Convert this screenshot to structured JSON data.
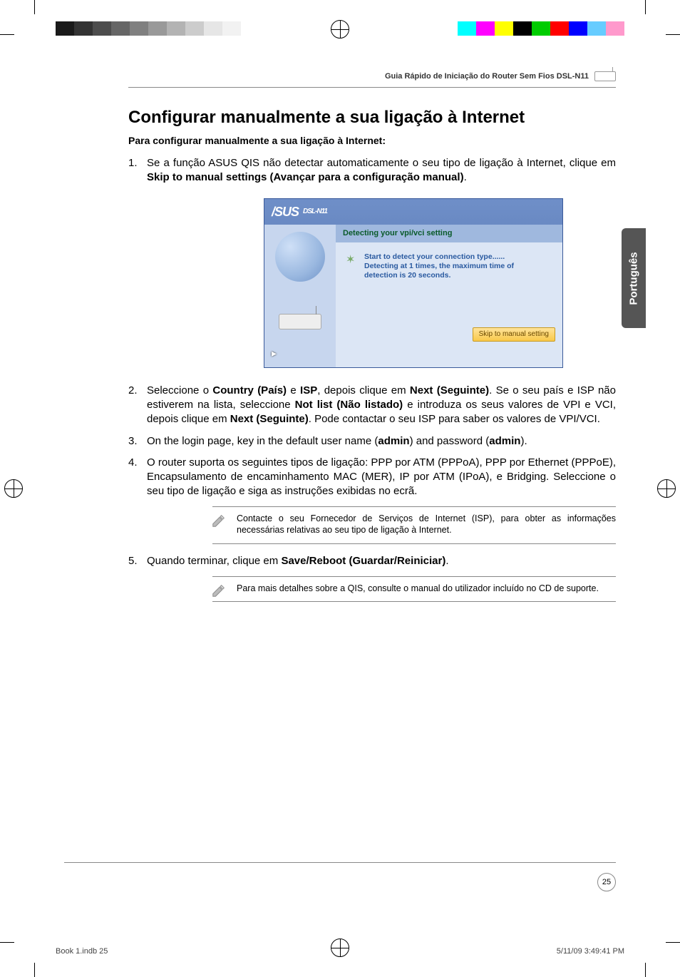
{
  "print": {
    "running_head": "Guia Rápido de Iniciação do Router Sem Fios DSL-N11",
    "side_tab": "Português",
    "page_number": "25",
    "slug_left": "Book 1.indb   25",
    "slug_right": "5/11/09   3:49:41 PM"
  },
  "content": {
    "h1": "Configurar manualmente a sua ligação à Internet",
    "lead": "Para configurar manualmente a sua ligação à Internet:",
    "steps": [
      {
        "num": "1.",
        "pre": "Se a função ASUS QIS não detectar automaticamente o seu tipo de ligação à Internet, clique em ",
        "bold": "Skip to manual settings (Avançar para a configuração manual)",
        "post": "."
      },
      {
        "num": "2.",
        "parts": [
          {
            "t": "Seleccione o "
          },
          {
            "b": "Country (País)"
          },
          {
            "t": " e "
          },
          {
            "b": "ISP"
          },
          {
            "t": ", depois clique em "
          },
          {
            "b": "Next (Seguinte)"
          },
          {
            "t": ". Se o seu país e ISP não estiverem na lista, seleccione "
          },
          {
            "b": "Not list (Não listado)"
          },
          {
            "t": " e introduza os seus valores de VPI e VCI, depois clique em "
          },
          {
            "b": "Next (Seguinte)"
          },
          {
            "t": ". Pode contactar o seu ISP para saber os valores de VPI/VCI."
          }
        ]
      },
      {
        "num": "3.",
        "parts": [
          {
            "t": "On the login page, key in the default user name ("
          },
          {
            "b": "admin"
          },
          {
            "t": ") and password ("
          },
          {
            "b": "admin"
          },
          {
            "t": ")."
          }
        ]
      },
      {
        "num": "4.",
        "parts": [
          {
            "t": "O router suporta os seguintes tipos de ligação: PPP por ATM (PPPoA), PPP por Ethernet (PPPoE), Encapsulamento de encaminhamento MAC (MER), IP por ATM (IPoA), e Bridging. Seleccione o seu tipo de ligação e siga as instruções exibidas no ecrã."
          }
        ]
      },
      {
        "num": "5.",
        "parts": [
          {
            "t": "Quando terminar, clique em "
          },
          {
            "b": "Save/Reboot (Guardar/Reiniciar)"
          },
          {
            "t": "."
          }
        ]
      }
    ],
    "note1": "Contacte o seu Fornecedor de Serviços de Internet (ISP), para obter as informações necessárias relativas ao seu tipo de ligação à Internet.",
    "note2": "Para mais detalhes sobre a QIS, consulte o manual do utilizador incluído no CD de suporte."
  },
  "screenshot": {
    "brand": "/SUS",
    "model": "DSL-N11",
    "bar": "Detecting your vpi/vci setting",
    "msg_l1": "Start to detect your connection type......",
    "msg_l2": "Detecting at 1 times, the maximum time of",
    "msg_l3": "detection is 20 seconds.",
    "button": "Skip to manual setting"
  }
}
